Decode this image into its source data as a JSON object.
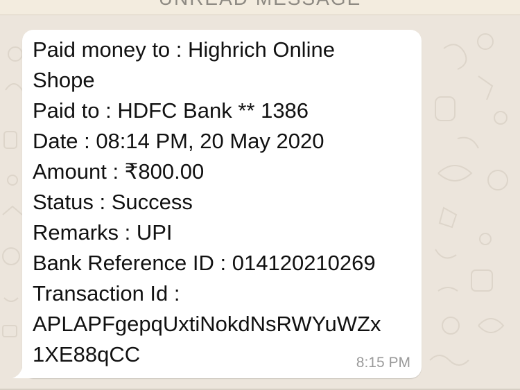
{
  "banner": {
    "label": "UNREAD MESSAGE"
  },
  "message": {
    "lines": [
      "Paid money to : Highrich Online",
      "Shope",
      "Paid to : HDFC Bank ** 1386",
      "Date : 08:14 PM, 20 May 2020",
      "Amount : ₹800.00",
      "Status : Success",
      "Remarks : UPI",
      "Bank Reference ID : 014120210269",
      "Transaction Id :",
      "APLAPFgepqUxtiNokdNsRWYuWZx",
      "1XE88qCC"
    ],
    "time": "8:15 PM"
  },
  "colors": {
    "wallpaper": "#ece5dc",
    "bubble": "#ffffff",
    "text": "#111111",
    "timestamp": "#9a9a9a"
  }
}
